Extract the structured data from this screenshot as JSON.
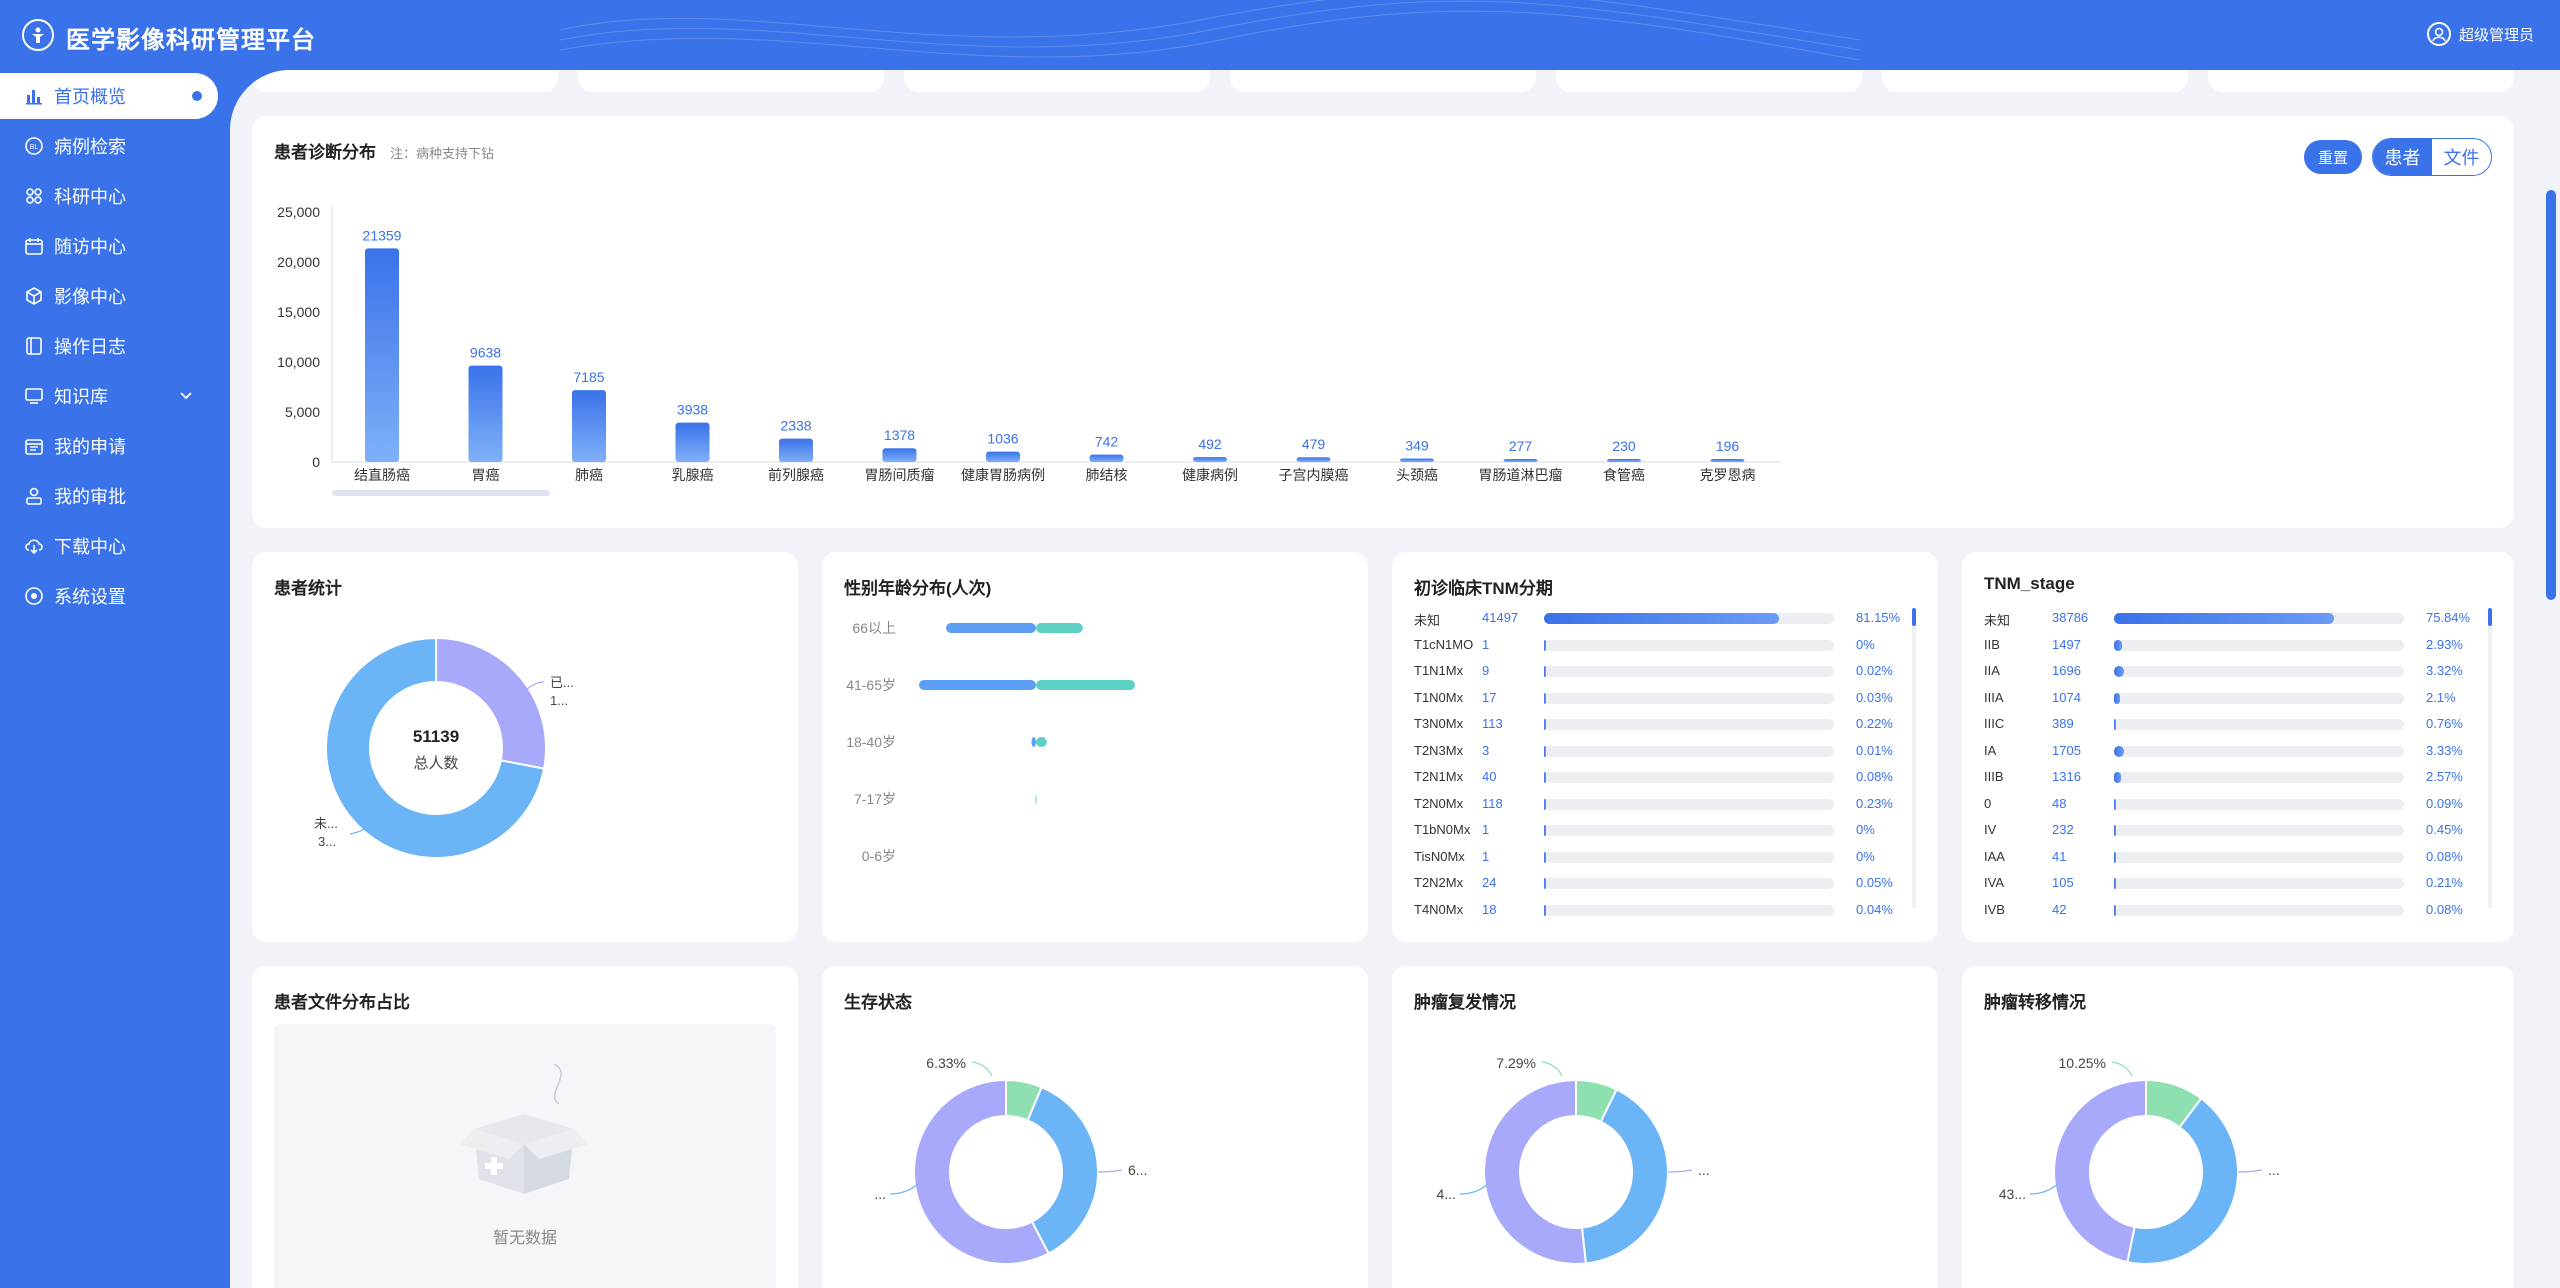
{
  "header": {
    "title": "医学影像科研管理平台",
    "user": "超级管理员"
  },
  "sidebar": {
    "items": [
      {
        "label": "首页概览",
        "icon": "bar-chart-icon"
      },
      {
        "label": "病例检索",
        "icon": "case-search-icon"
      },
      {
        "label": "科研中心",
        "icon": "research-icon"
      },
      {
        "label": "随访中心",
        "icon": "calendar-icon"
      },
      {
        "label": "影像中心",
        "icon": "cube-icon"
      },
      {
        "label": "操作日志",
        "icon": "log-icon"
      },
      {
        "label": "知识库",
        "icon": "monitor-icon"
      },
      {
        "label": "我的申请",
        "icon": "apply-icon"
      },
      {
        "label": "我的审批",
        "icon": "approve-icon"
      },
      {
        "label": "下载中心",
        "icon": "cloud-download-icon"
      },
      {
        "label": "系统设置",
        "icon": "settings-icon"
      }
    ]
  },
  "diagnosis": {
    "title": "患者诊断分布",
    "note": "注：病种支持下钻",
    "reset_label": "重置",
    "toggle": [
      "患者",
      "文件"
    ]
  },
  "patient_stats": {
    "title": "患者统计",
    "total": "51139",
    "total_label": "总人数",
    "label_a": "已...",
    "label_a2": "1...",
    "label_b": "未...",
    "label_b2": "3..."
  },
  "gender_age": {
    "title": "性别年龄分布(人次)"
  },
  "tnm": {
    "title": "初诊临床TNM分期",
    "rows": [
      {
        "label": "未知",
        "count": "41497",
        "pct": "81.15%",
        "frac": 0.8115
      },
      {
        "label": "T1cN1MO",
        "count": "1",
        "pct": "0%",
        "frac": 0
      },
      {
        "label": "T1N1Mx",
        "count": "9",
        "pct": "0.02%",
        "frac": 0.0002
      },
      {
        "label": "T1N0Mx",
        "count": "17",
        "pct": "0.03%",
        "frac": 0.0003
      },
      {
        "label": "T3N0Mx",
        "count": "113",
        "pct": "0.22%",
        "frac": 0.0022
      },
      {
        "label": "T2N3Mx",
        "count": "3",
        "pct": "0.01%",
        "frac": 0.0001
      },
      {
        "label": "T2N1Mx",
        "count": "40",
        "pct": "0.08%",
        "frac": 0.0008
      },
      {
        "label": "T2N0Mx",
        "count": "118",
        "pct": "0.23%",
        "frac": 0.0023
      },
      {
        "label": "T1bN0Mx",
        "count": "1",
        "pct": "0%",
        "frac": 0
      },
      {
        "label": "TisN0Mx",
        "count": "1",
        "pct": "0%",
        "frac": 0
      },
      {
        "label": "T2N2Mx",
        "count": "24",
        "pct": "0.05%",
        "frac": 0.0005
      },
      {
        "label": "T4N0Mx",
        "count": "18",
        "pct": "0.04%",
        "frac": 0.0004
      }
    ]
  },
  "tnm_stage": {
    "title": "TNM_stage",
    "rows": [
      {
        "label": "未知",
        "count": "38786",
        "pct": "75.84%",
        "frac": 0.7584
      },
      {
        "label": "IIB",
        "count": "1497",
        "pct": "2.93%",
        "frac": 0.0293
      },
      {
        "label": "IIA",
        "count": "1696",
        "pct": "3.32%",
        "frac": 0.0332
      },
      {
        "label": "IIIA",
        "count": "1074",
        "pct": "2.1%",
        "frac": 0.021
      },
      {
        "label": "IIIC",
        "count": "389",
        "pct": "0.76%",
        "frac": 0.0076
      },
      {
        "label": "IA",
        "count": "1705",
        "pct": "3.33%",
        "frac": 0.0333
      },
      {
        "label": "IIIB",
        "count": "1316",
        "pct": "2.57%",
        "frac": 0.0257
      },
      {
        "label": "0",
        "count": "48",
        "pct": "0.09%",
        "frac": 0.0009
      },
      {
        "label": "IV",
        "count": "232",
        "pct": "0.45%",
        "frac": 0.0045
      },
      {
        "label": "IAA",
        "count": "41",
        "pct": "0.08%",
        "frac": 0.0008
      },
      {
        "label": "IVA",
        "count": "105",
        "pct": "0.21%",
        "frac": 0.0021
      },
      {
        "label": "IVB",
        "count": "42",
        "pct": "0.08%",
        "frac": 0.0008
      }
    ]
  },
  "file_dist": {
    "title": "患者文件分布占比",
    "empty": "暂无数据"
  },
  "survival": {
    "title": "生存状态",
    "label_small": "6.33%",
    "label_left": "...",
    "label_right": "6..."
  },
  "recurrence": {
    "title": "肿瘤复发情况",
    "label_small": "7.29%",
    "label_left": "4...",
    "label_right": "..."
  },
  "metastasis": {
    "title": "肿瘤转移情况",
    "label_small": "10.25%",
    "label_left": "43...",
    "label_right": "..."
  },
  "colors": {
    "primary": "#3a72e9",
    "purple": "#a9a9fb",
    "blue": "#6bb5f7",
    "green": "#8fe0b0",
    "teal": "#5dd0c6"
  },
  "chart_data": [
    {
      "type": "bar",
      "title": "患者诊断分布",
      "categories": [
        "结直肠癌",
        "胃癌",
        "肺癌",
        "乳腺癌",
        "前列腺癌",
        "胃肠间质瘤",
        "健康胃肠病例",
        "肺结核",
        "健康病例",
        "子宫内膜癌",
        "头颈癌",
        "胃肠道淋巴瘤",
        "食管癌",
        "克罗恩病"
      ],
      "values": [
        21359,
        9638,
        7185,
        3938,
        2338,
        1378,
        1036,
        742,
        492,
        479,
        349,
        277,
        230,
        196
      ],
      "ylim": [
        0,
        25000
      ],
      "yticks": [
        0,
        5000,
        10000,
        15000,
        20000,
        25000
      ],
      "ytick_labels": [
        "0",
        "5,000",
        "10,000",
        "15,000",
        "20,000",
        "25,000"
      ]
    },
    {
      "type": "pie",
      "title": "患者统计",
      "values": [
        28,
        72
      ],
      "total": 51139
    },
    {
      "type": "bar",
      "title": "性别年龄分布(人次)",
      "categories": [
        "66以上",
        "41-65岁",
        "18-40岁",
        "7-17岁",
        "0-6岁"
      ],
      "series": [
        {
          "values": [
            100,
            130,
            5,
            0.5,
            0
          ]
        },
        {
          "values": [
            52,
            110,
            12,
            0.5,
            0
          ]
        }
      ]
    },
    {
      "type": "pie",
      "title": "生存状态",
      "values": [
        6.33,
        36,
        57.67
      ]
    },
    {
      "type": "pie",
      "title": "肿瘤复发情况",
      "values": [
        7.29,
        41,
        51.71
      ]
    },
    {
      "type": "pie",
      "title": "肿瘤转移情况",
      "values": [
        10.25,
        43,
        46.75
      ]
    }
  ]
}
